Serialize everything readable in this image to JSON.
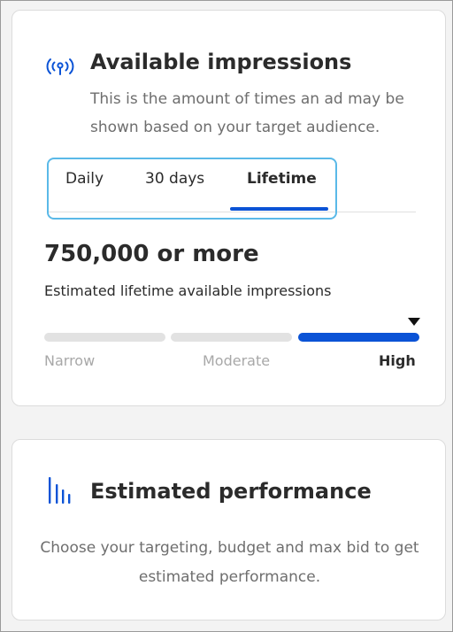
{
  "impressions": {
    "icon": "broadcast-signal-icon",
    "title": "Available impressions",
    "description": "This is the amount of times an ad may be shown based on your target audience.",
    "tabs": [
      {
        "label": "Daily",
        "active": false
      },
      {
        "label": "30 days",
        "active": false
      },
      {
        "label": "Lifetime",
        "active": true
      }
    ],
    "value": "750,000 or more",
    "value_label": "Estimated lifetime available impressions",
    "range": {
      "labels": [
        "Narrow",
        "Moderate",
        "High"
      ],
      "selected": "High"
    }
  },
  "performance": {
    "icon": "bar-chart-icon",
    "title": "Estimated performance",
    "description": "Choose your targeting, budget and max bid to get estimated performance."
  },
  "colors": {
    "accent": "#0b53d6",
    "focus_ring": "#5ab9e8",
    "inactive_segment": "#e2e2e2",
    "muted_text": "#6e6e6e"
  }
}
